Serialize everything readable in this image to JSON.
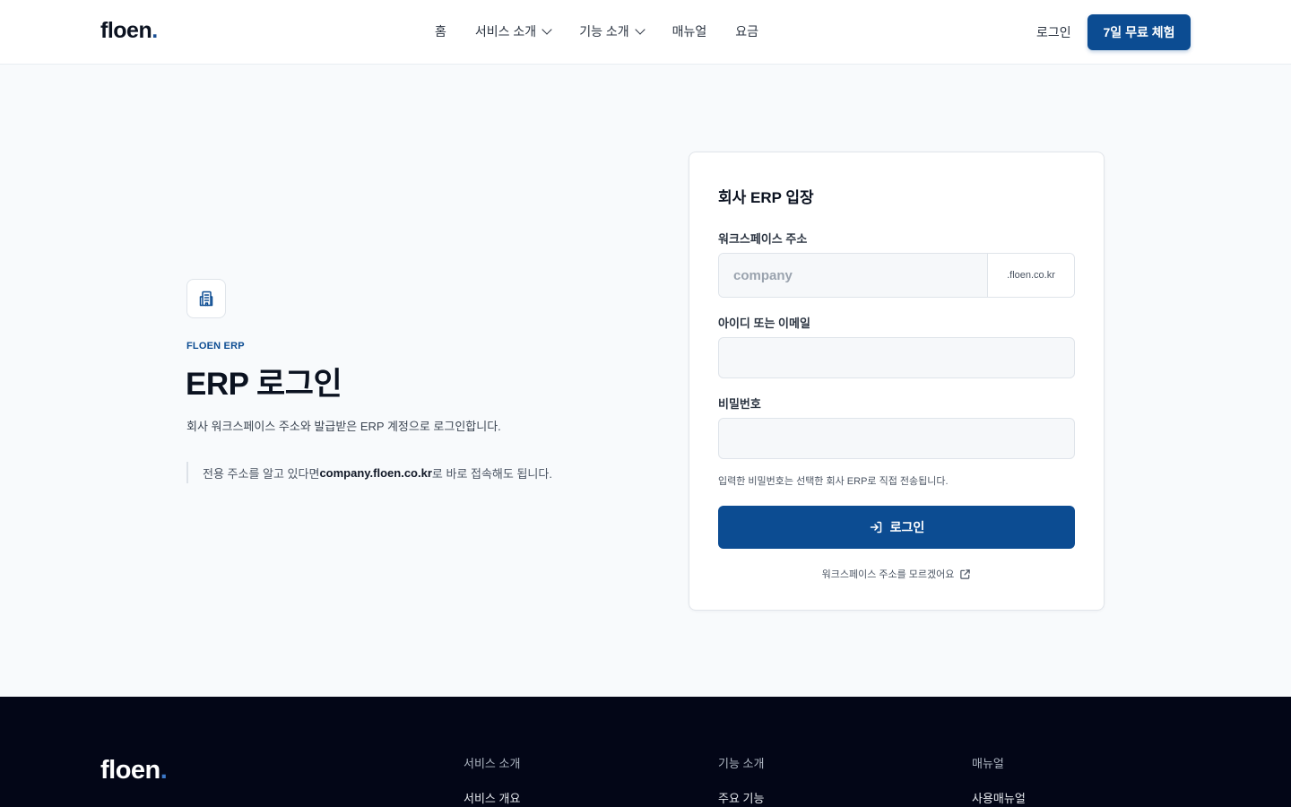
{
  "header": {
    "logo": "floen",
    "logo_dot": ".",
    "nav": [
      {
        "label": "홈",
        "dropdown": false
      },
      {
        "label": "서비스 소개",
        "dropdown": true
      },
      {
        "label": "기능 소개",
        "dropdown": true
      },
      {
        "label": "매뉴얼",
        "dropdown": false
      },
      {
        "label": "요금",
        "dropdown": false
      }
    ],
    "login_label": "로그인",
    "trial_label": "7일 무료 체험"
  },
  "intro": {
    "icon": "building-icon",
    "eyebrow": "FLOEN ERP",
    "title": "ERP 로그인",
    "description": "회사 워크스페이스 주소와 발급받은 ERP 계정으로 로그인합니다.",
    "hint_prefix": "전용 주소를 알고 있다면 ",
    "hint_domain": "company.floen.co.kr",
    "hint_suffix": "로 바로 접속해도 됩니다."
  },
  "login_card": {
    "title": "회사 ERP 입장",
    "workspace_label": "워크스페이스 주소",
    "workspace_placeholder": "company",
    "workspace_value": "",
    "workspace_suffix": ".floen.co.kr",
    "id_label": "아이디 또는 이메일",
    "id_value": "",
    "password_label": "비밀번호",
    "password_value": "",
    "note": "입력한 비밀번호는 선택한 회사 ERP로 직접 전송됩니다.",
    "submit_label": "로그인",
    "submit_icon": "login-arrow-icon",
    "help_link": "워크스페이스 주소를 모르겠어요",
    "help_icon": "external-link-icon"
  },
  "footer": {
    "logo": "floen",
    "logo_dot": ".",
    "columns": [
      {
        "heading": "서비스 소개",
        "links": [
          "서비스 개요"
        ]
      },
      {
        "heading": "기능 소개",
        "links": [
          "주요 기능"
        ]
      },
      {
        "heading": "매뉴얼",
        "links": [
          "사용매뉴얼"
        ]
      }
    ]
  },
  "colors": {
    "primary": "#0c4c92",
    "background": "#f8fafc",
    "footer_bg": "#030617"
  }
}
